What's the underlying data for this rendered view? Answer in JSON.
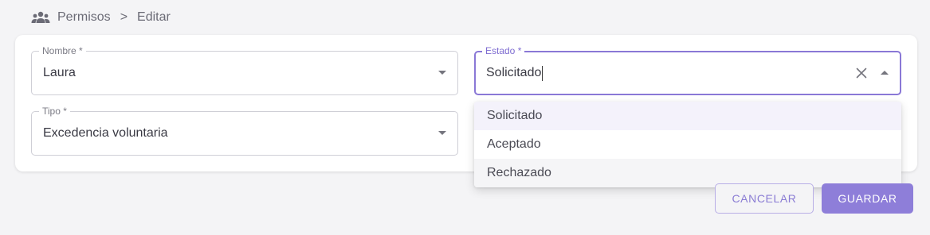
{
  "breadcrumb": {
    "icon": "people-icon",
    "section": "Permisos",
    "separator": ">",
    "current": "Editar"
  },
  "form": {
    "nombre": {
      "label": "Nombre *",
      "value": "Laura"
    },
    "tipo": {
      "label": "Tipo *",
      "value": "Excedencia voluntaria"
    },
    "estado": {
      "label": "Estado *",
      "value": "Solicitado",
      "options": [
        "Solicitado",
        "Aceptado",
        "Rechazado"
      ]
    }
  },
  "actions": {
    "cancel_label": "CANCELAR",
    "save_label": "GUARDAR"
  },
  "colors": {
    "accent": "#8e7ed9",
    "focus_border": "#8a78d6"
  }
}
